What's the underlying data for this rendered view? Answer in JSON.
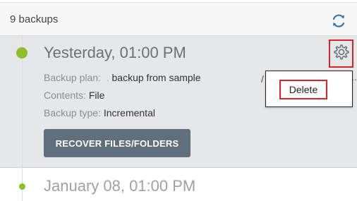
{
  "header": {
    "backup_count": "9 backups"
  },
  "selected_backup": {
    "title": "Yesterday, 01:00 PM",
    "fields": [
      {
        "label": "Backup plan:",
        "value": "backup from sample"
      },
      {
        "label": "Contents:",
        "value": "File"
      },
      {
        "label": "Backup type:",
        "value": "Incremental"
      }
    ],
    "recover_button": "RECOVER FILES/FOLDERS"
  },
  "context_menu": {
    "delete_label": "Delete"
  },
  "next_backup": {
    "title": "January 08, 01:00 PM"
  },
  "colors": {
    "accent_green": "#8cbf2a",
    "button_slate": "#5f6f7b",
    "highlight_red": "#d9232a",
    "refresh_blue": "#2f76b8"
  },
  "icons": [
    "refresh-icon",
    "gear-icon"
  ]
}
